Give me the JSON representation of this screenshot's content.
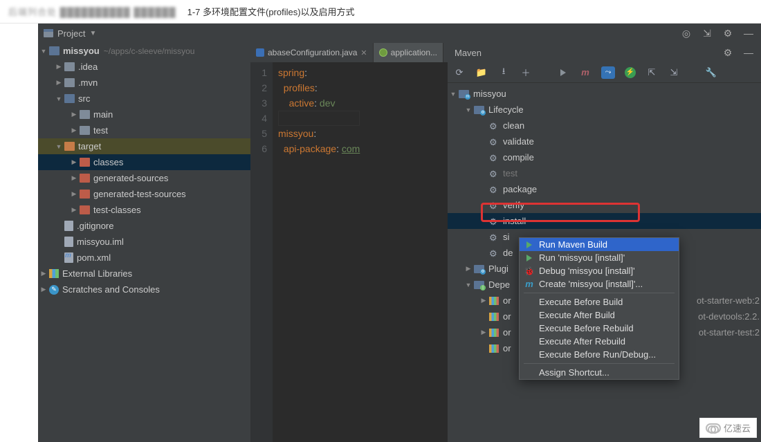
{
  "top": {
    "blur": "后端列合处     ██████████ ██████",
    "title": "1-7 多环境配置文件(profiles)以及启用方式"
  },
  "project_label": "Project",
  "tree": {
    "root": {
      "name": "missyou",
      "path": "~/apps/c-sleeve/missyou"
    },
    "idea": ".idea",
    "mvn": ".mvn",
    "src": "src",
    "main": "main",
    "test": "test",
    "target": "target",
    "classes": "classes",
    "gensrc": "generated-sources",
    "gentest": "generated-test-sources",
    "testcls": "test-classes",
    "gitignore": ".gitignore",
    "iml": "missyou.iml",
    "pom": "pom.xml",
    "ext": "External Libraries",
    "scratch": "Scratches and Consoles"
  },
  "tabs": {
    "t1": "abaseConfiguration.java",
    "t2": "application..."
  },
  "code": {
    "l1a": "spring",
    "l1b": ":",
    "l2a": "profiles",
    "l2b": ":",
    "l3a": "active",
    "l3b": ": ",
    "l3c": "dev",
    "l5a": "missyou",
    "l5b": ":",
    "l6a": "api-package",
    "l6b": ": ",
    "l6c": "com"
  },
  "maven": {
    "title": "Maven",
    "root": "missyou",
    "lifecycle": "Lifecycle",
    "goals": {
      "clean": "clean",
      "validate": "validate",
      "compile": "compile",
      "test": "test",
      "package": "package",
      "verify": "verify",
      "install": "install",
      "site": "si",
      "deploy": "de"
    },
    "plugins": "Plugi",
    "deps": "Depe",
    "dep_items": {
      "d1": "or",
      "d2": "or",
      "d3": "or",
      "d4": "or"
    },
    "dep_suffix": {
      "s1": "ot-starter-web:2",
      "s2": "ot-devtools:2.2.",
      "s3": "ot-starter-test:2"
    }
  },
  "ctx": {
    "run_build": "Run Maven Build",
    "run_install": "Run 'missyou [install]'",
    "debug_install": "Debug 'missyou [install]'",
    "create": "Create 'missyou [install]'...",
    "before_build": "Execute Before Build",
    "after_build": "Execute After Build",
    "before_rebuild": "Execute Before Rebuild",
    "after_rebuild": "Execute After Rebuild",
    "before_run": "Execute Before Run/Debug...",
    "shortcut": "Assign Shortcut..."
  },
  "watermark": "亿速云"
}
